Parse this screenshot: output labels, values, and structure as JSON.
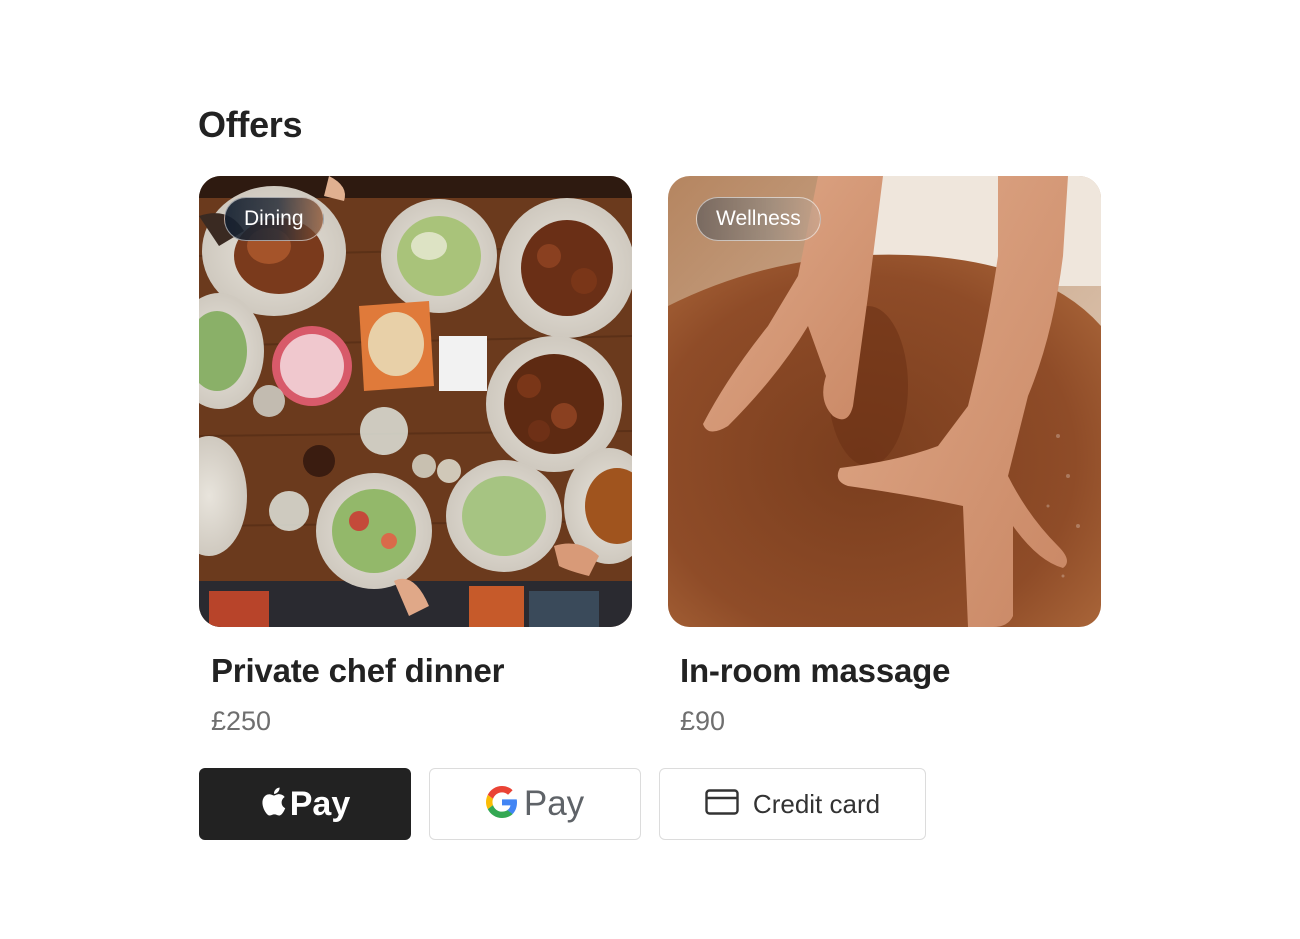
{
  "section": {
    "title": "Offers"
  },
  "offers": [
    {
      "tag": "Dining",
      "title": "Private chef dinner",
      "price": "£250",
      "image": "dining-table-photo"
    },
    {
      "tag": "Wellness",
      "title": "In-room massage",
      "price": "£90",
      "image": "massage-photo"
    }
  ],
  "payment": {
    "apple_pay": {
      "label": "Pay",
      "icon": "apple-icon"
    },
    "google_pay": {
      "label": "Pay",
      "icon": "google-g-icon"
    },
    "credit_card": {
      "label": "Credit card",
      "icon": "credit-card-icon"
    }
  },
  "colors": {
    "text_primary": "#222222",
    "text_price": "#6f6f6f",
    "apple_pay_bg": "#222222",
    "button_border": "#dcdcdc",
    "google_blue": "#4285F4",
    "google_red": "#EA4335",
    "google_yellow": "#FBBC05",
    "google_green": "#34A853"
  }
}
